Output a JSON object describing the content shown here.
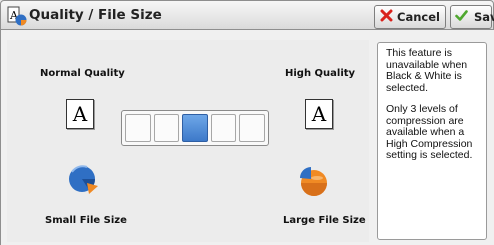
{
  "titlebar": {
    "title": "Quality / File Size",
    "cancel_label": "Cancel",
    "save_label": "Save"
  },
  "quality": {
    "normal_label": "Normal Quality",
    "high_label": "High Quality",
    "normal_glyph": "A",
    "high_glyph": "A",
    "levels_total": 5,
    "selected_level": 3
  },
  "file_size": {
    "small_label": "Small File Size",
    "large_label": "Large File Size"
  },
  "info": {
    "paragraph1": "This feature is unavailable when Black & White is selected.",
    "paragraph2": "Only 3 levels of compression are available when a High Compression setting is selected."
  },
  "icons": {
    "title": "quality-file-size-icon",
    "cancel": "red-x-icon",
    "save": "checkmark-icon",
    "small_file": "small-pie-icon",
    "large_file": "large-pie-icon"
  },
  "colors": {
    "accent_blue": "#3d79c9",
    "pie_blue": "#2f6fc4",
    "pie_orange": "#f08a24",
    "cancel_red": "#d9221c",
    "save_green": "#4fa82f"
  }
}
